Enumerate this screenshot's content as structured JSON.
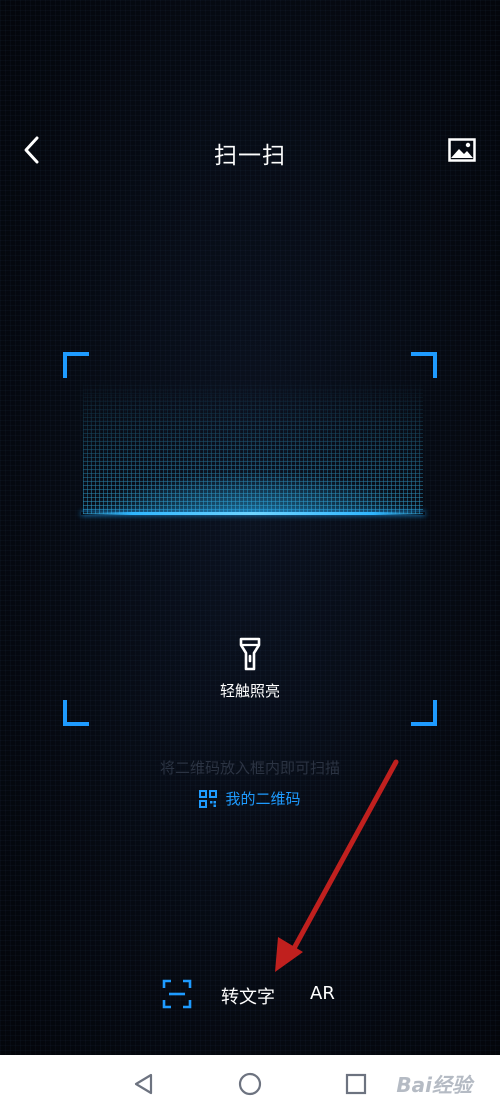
{
  "header": {
    "title": "扫一扫",
    "back_icon": "chevron-left-icon",
    "gallery_icon": "image-icon"
  },
  "scanner": {
    "frame_color": "#1e9bff",
    "torch_label": "轻触照亮",
    "torch_icon": "flashlight-icon",
    "hint": "将二维码放入框内即可扫描",
    "my_qr_label": "我的二维码",
    "my_qr_icon": "qr-code-icon"
  },
  "modes": {
    "scan_icon": "scan-icon",
    "text_label": "转文字",
    "ar_label": "AR"
  },
  "navbar": {
    "back_icon": "triangle-back-icon",
    "home_icon": "circle-home-icon",
    "recent_icon": "square-recent-icon",
    "watermark": "Bai经验"
  },
  "annotation": {
    "arrow_color": "#c0201e"
  }
}
